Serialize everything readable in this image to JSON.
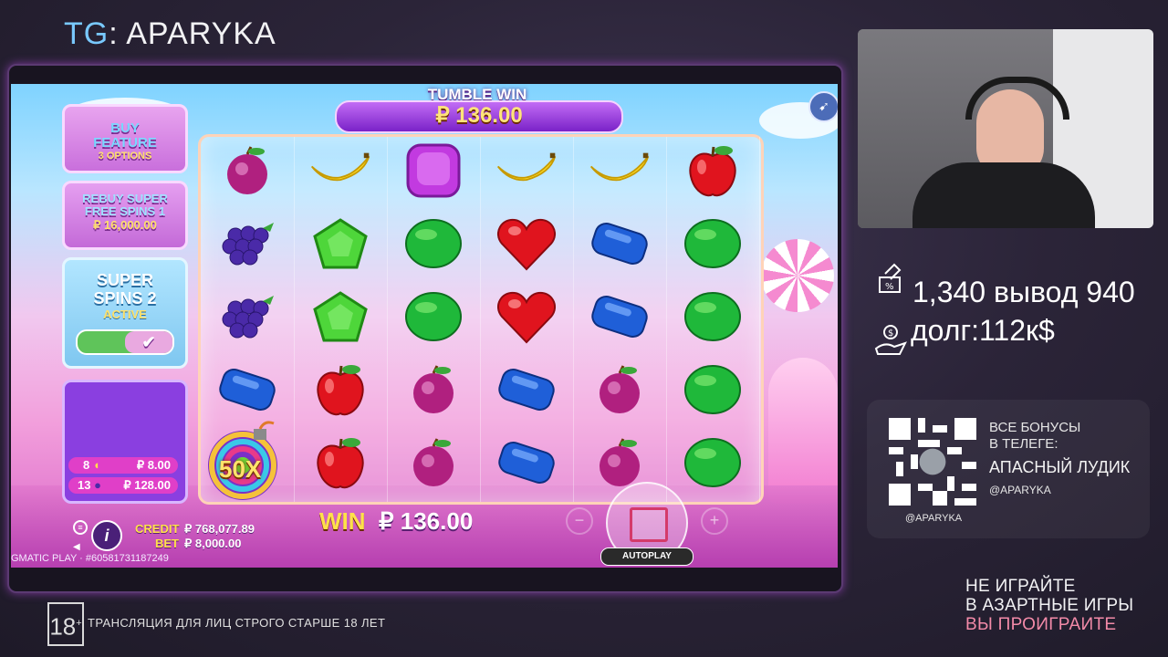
{
  "stream": {
    "tg_prefix": "TG",
    "tg_name": ": APARYKA",
    "stats_line1": "1,340 вывод 940",
    "stats_line2": "долг:112к$",
    "qr_line1": "ВСЕ БОНУСЫ",
    "qr_line2": "В ТЕЛЕГЕ:",
    "qr_line3": "АПАСНЫЙ ЛУДИК",
    "qr_handle": "@APARYKA",
    "qr_handle_below": "@APARYKA",
    "warning_line1": "НЕ ИГРАЙТЕ",
    "warning_line2": "В АЗАРТНЫЕ ИГРЫ",
    "warning_line3": "ВЫ ПРОИГРАИТЕ",
    "age_badge": "18",
    "age_sup": "+",
    "age_text": "ТРАНСЛЯЦИЯ ДЛЯ ЛИЦ СТРОГО СТАРШЕ 18 ЛЕТ"
  },
  "game": {
    "tumble_label": "TUMBLE WIN",
    "tumble_value": "₽ 136.00",
    "buy_feature_line1": "BUY",
    "buy_feature_line2": "FEATURE",
    "buy_feature_sub": "3 OPTIONS",
    "rebuy_line1": "REBUY SUPER",
    "rebuy_line2": "FREE SPINS 1",
    "rebuy_price": "₽ 16,000.00",
    "super_line1": "SUPER",
    "super_line2": "SPINS 2",
    "super_status": "ACTIVE",
    "pay1_count": "8",
    "pay1_value": "₽ 8.00",
    "pay2_count": "13",
    "pay2_value": "₽ 128.00",
    "multiplier": "50X",
    "credit_label": "CREDIT",
    "credit_value": "₽ 768,077.89",
    "bet_label": "BET",
    "bet_value": "₽ 8,000.00",
    "win_label": "WIN",
    "win_value": "₽ 136.00",
    "autoplay_label": "AUTOPLAY",
    "footer_text": "GMATIC PLAY · #60581731187249",
    "info_glyph": "i",
    "minus_glyph": "−",
    "plus_glyph": "+",
    "reels": [
      [
        "plum",
        "grapes",
        "grapes",
        "blue",
        "bomb"
      ],
      [
        "banana",
        "green-pentagon",
        "green-pentagon",
        "apple",
        "apple"
      ],
      [
        "purple-square",
        "green-oval",
        "green-oval",
        "plum",
        "plum"
      ],
      [
        "banana",
        "heart",
        "heart",
        "blue",
        "blue"
      ],
      [
        "banana",
        "blue",
        "blue",
        "plum",
        "plum"
      ],
      [
        "apple",
        "green-oval",
        "green-oval",
        "green-oval",
        "green-oval"
      ]
    ]
  }
}
